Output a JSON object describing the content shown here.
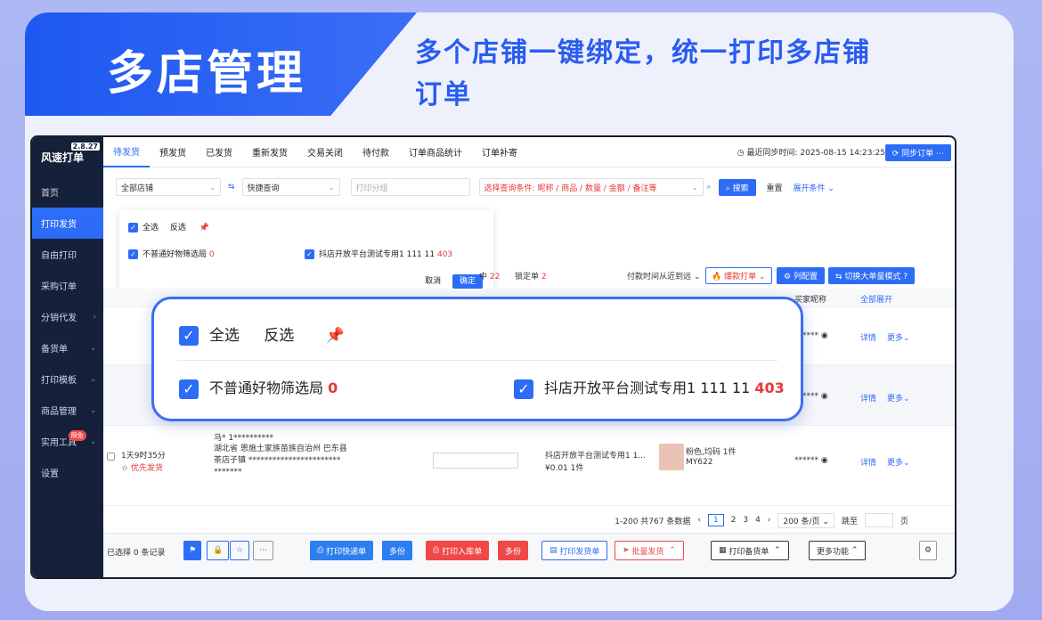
{
  "banner": {
    "title": "多店管理",
    "subtitle": "多个店铺一键绑定，统一打印多店铺订单"
  },
  "app": {
    "name": "风速打单",
    "version": "2.8.27",
    "sidebar": [
      {
        "label": "首页",
        "active": false,
        "chev": ""
      },
      {
        "label": "打印发货",
        "active": true,
        "chev": ""
      },
      {
        "label": "自由打印",
        "active": false,
        "chev": ""
      },
      {
        "label": "采购订单",
        "active": false,
        "chev": ""
      },
      {
        "label": "分销代发",
        "active": false,
        "chev": "›"
      },
      {
        "label": "备货单",
        "active": false,
        "chev": "⌄"
      },
      {
        "label": "打印模板",
        "active": false,
        "chev": "⌄"
      },
      {
        "label": "商品管理",
        "active": false,
        "chev": "⌄"
      },
      {
        "label": "实用工具",
        "active": false,
        "chev": "⌄"
      },
      {
        "label": "设置",
        "active": false,
        "chev": ""
      }
    ],
    "new_badge": "限免",
    "tabs": [
      "待发货",
      "预发货",
      "已发货",
      "重新发货",
      "交易关闭",
      "待付款",
      "订单商品统计",
      "订单补寄"
    ],
    "sync_time": "最近同步时间: 2025-08-15 14:23:25",
    "sync_button": "同步订单",
    "filters": {
      "shop": "全部店铺",
      "quick_query": "快捷查询",
      "print_group_placeholder": "打印分组",
      "condition": "选择查询条件: 昵称 / 商品 / 数量 / 金额 / 备注等",
      "search": "搜索",
      "reset": "重置",
      "expand": "展开条件"
    },
    "mini_popup": {
      "select_all": "全选",
      "invert": "反选",
      "shop1": "不普通好物筛选局",
      "shop1_count": "0",
      "shop2": "抖店开放平台测试专用1 111 11",
      "shop2_count": "403",
      "cancel": "取消",
      "confirm": "确定"
    },
    "toolbar": {
      "count_label": "22",
      "locked": "锁定单",
      "locked_count": "2",
      "sort": "付款时间从近到远",
      "hot_print": "爆款打单",
      "columns": "列配置",
      "switch": "切换大单量模式"
    },
    "table_head": {
      "buyer": "买家昵称",
      "expand_all": "全部展开"
    },
    "orders": [
      {
        "masked": "****** ",
        "detail": "详情",
        "more": "更多"
      },
      {
        "masked": "****** ",
        "detail": "详情",
        "more": "更多"
      },
      {
        "time": "1天9时35分",
        "priority": "优先发货",
        "name": "马* 1**********",
        "address": "湖北省 恩施土家族苗族自治州 巴东县 茶店子镇 *********************** *******",
        "shop": "抖店开放平台测试专用1 1...",
        "price": "¥0.01",
        "qty": "1件",
        "sku": "粉色,均码 1件",
        "sku_code": "MY622",
        "masked": "****** ",
        "detail": "详情",
        "more": "更多"
      }
    ],
    "pager": {
      "summary": "1-200 共767 条数据",
      "pages": [
        "1",
        "2",
        "3",
        "4"
      ],
      "size": "200 条/页",
      "jump": "跳至",
      "page_unit": "页"
    },
    "bottom": {
      "selected": "已选择 0 条记录",
      "print_express": "打印快递单",
      "multi": "多份",
      "print_inbound": "打印入库单",
      "multi2": "多份",
      "print_ship": "打印发货单",
      "batch_ship": "批量发货",
      "print_stock": "打印备货单",
      "more": "更多功能"
    }
  },
  "big_popup": {
    "select_all": "全选",
    "invert": "反选",
    "shop1": "不普通好物筛选局",
    "shop1_count": "0",
    "shop2": "抖店开放平台测试专用1 111 11",
    "shop2_count": "403"
  }
}
